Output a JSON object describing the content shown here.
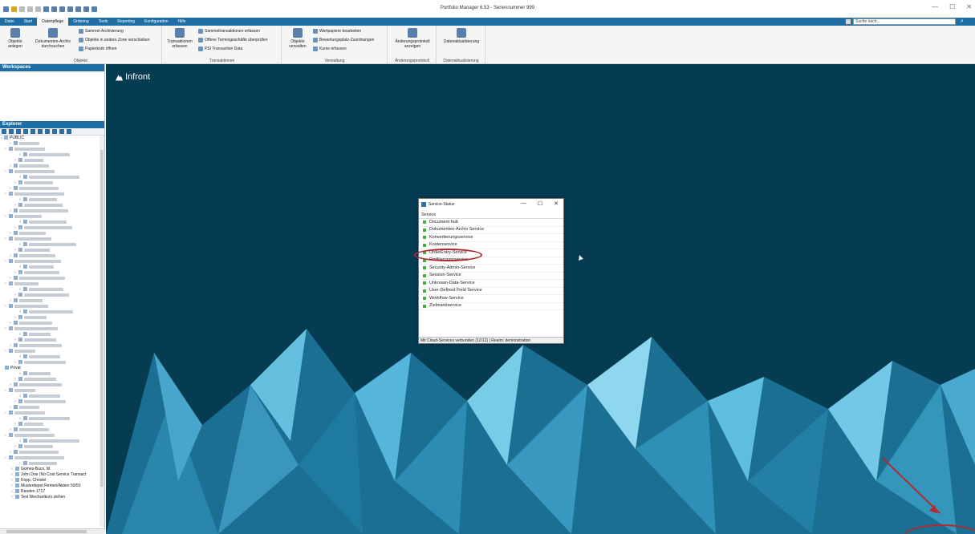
{
  "window": {
    "title": "Portfolio Manager 6.53 - Seriennummer 999",
    "controls": [
      "—",
      "☐",
      "✕"
    ]
  },
  "ribbon_tabs": [
    {
      "label": "Datei"
    },
    {
      "label": "Start"
    },
    {
      "label": "Datenpflege"
    },
    {
      "label": "Ordering"
    },
    {
      "label": "Tools"
    },
    {
      "label": "Reporting"
    },
    {
      "label": "Konfiguration"
    },
    {
      "label": "Hilfe"
    }
  ],
  "search": {
    "placeholder": "Suche nach..."
  },
  "ribbon_groups": {
    "objekte": {
      "label": "Objekte",
      "objekte_anlegen": "Objekte anlegen",
      "dokumenten_archiv": "Dokumenten-Archiv durchsuchen",
      "sammel_archivierung": "Sammel-Archivierung",
      "zone_verschieben": "Objekte in andere Zone verschieben",
      "papierkorb": "Papierkorb öffnen"
    },
    "transaktionen": {
      "label": "Transaktionen",
      "erfassen": "Transaktionen erfassen",
      "sammeltransaktionen": "Sammeltransaktionen erfassen",
      "termingeschaefte": "Offene Termingeschäfte überprüfen",
      "psi": "PSI Transaction Data"
    },
    "verwaltung": {
      "label": "Verwaltung",
      "objekte_verwalten": "Objekte verwalten",
      "wertpapiere": "Wertpapiere bearbeiten",
      "bewertungsplatz": "Bewertungsplatz-Zuordnungen",
      "kurse": "Kurse erfassen"
    },
    "aenderungsprotokoll": {
      "label": "Änderungsprotokoll",
      "anzeigen": "Änderungsprotokoll anzeigen"
    },
    "datenaktualisierung": {
      "label": "Datenaktualisierung",
      "button": "Datenaktualisierung"
    }
  },
  "sidebar": {
    "workspaces_title": "Workspaces",
    "explorer_title": "Explorer",
    "root_label": "PUBLIC",
    "privat_label": "Privat",
    "named_rows": [
      "Gomes-Buco, M.",
      "John Doe (No Cost Service Transact",
      "Kopp, Christel",
      "Musterdepot Renten/Aktien 50/50",
      "Runden 1717",
      "Test Wechselkurs ziehen"
    ]
  },
  "main": {
    "logo_text": "Infront"
  },
  "dialog": {
    "title": "Service-Status",
    "column_header": "Service",
    "services": [
      "Document hub",
      "Dokumenten-Archiv Service",
      "Konvertierungsservice",
      "Kostenservice",
      "OrderEntry-Service",
      "Profilierungsservice",
      "Security-Admin-Service",
      "Session-Service",
      "Unknown-Data-Service",
      "User-Defined Field Service",
      "Workflow-Service",
      "Zielmarktservice"
    ],
    "status_bar": "Mit Cloud-Services verbunden (12/12) | Realm: demonstration",
    "status_color": "#3db33d",
    "highlight_color": "#b2292e"
  },
  "colors": {
    "accent": "#1d6fa5",
    "background": "#053c52"
  }
}
